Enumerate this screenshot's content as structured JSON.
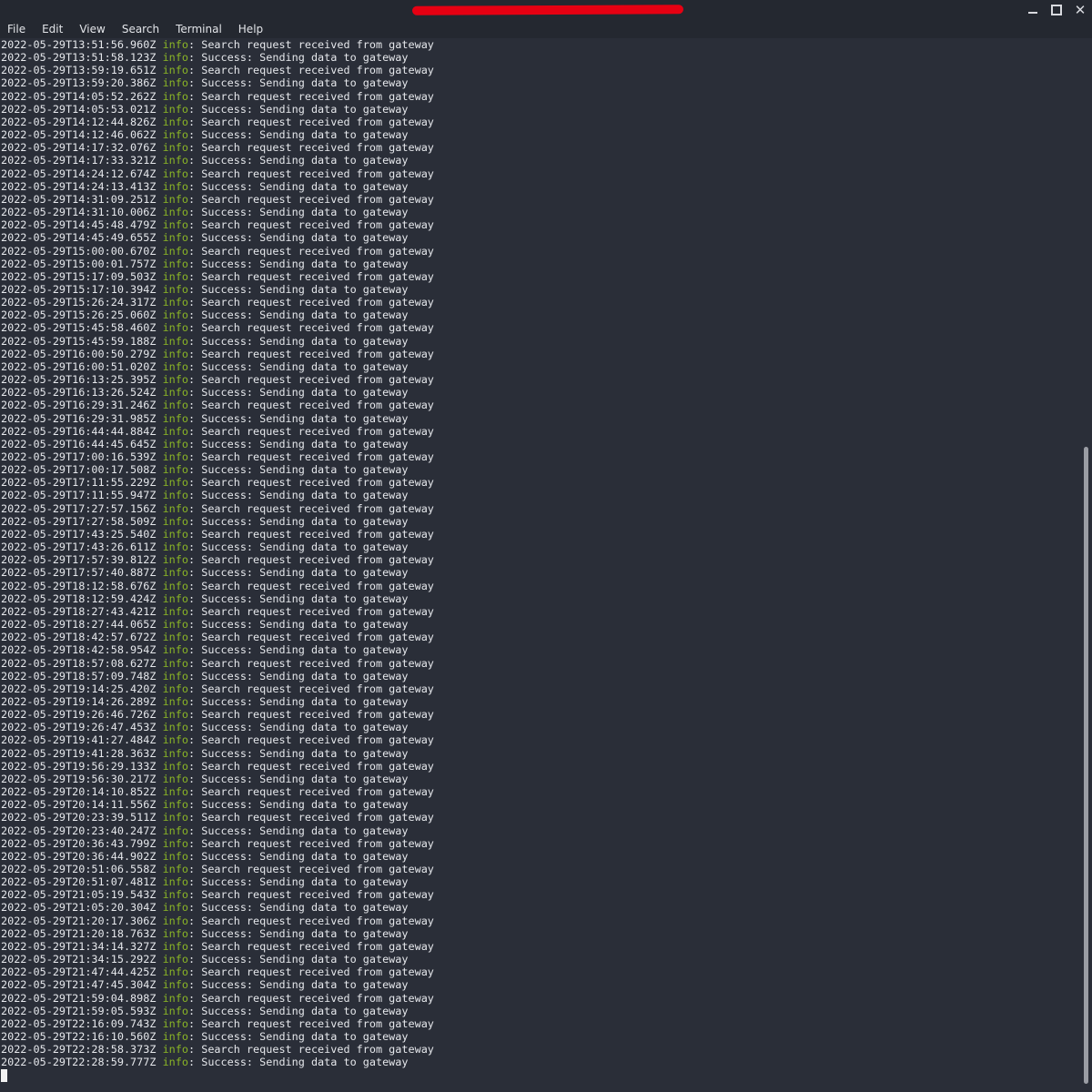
{
  "window": {
    "controls": {
      "minimize_icon": "minimize-icon",
      "maximize_icon": "maximize-icon",
      "close_glyph": "✕"
    }
  },
  "menu": [
    "File",
    "Edit",
    "View",
    "Search",
    "Terminal",
    "Help"
  ],
  "terminal": {
    "level_label": "info",
    "colors": {
      "background": "#2a2e38",
      "text": "#e6e8ec",
      "level": "#8ab526"
    },
    "log": [
      {
        "ts": "2022-05-29T13:51:56.960Z",
        "msg": "Search request received from gateway"
      },
      {
        "ts": "2022-05-29T13:51:58.123Z",
        "msg": "Success: Sending data to gateway"
      },
      {
        "ts": "2022-05-29T13:59:19.651Z",
        "msg": "Search request received from gateway"
      },
      {
        "ts": "2022-05-29T13:59:20.386Z",
        "msg": "Success: Sending data to gateway"
      },
      {
        "ts": "2022-05-29T14:05:52.262Z",
        "msg": "Search request received from gateway"
      },
      {
        "ts": "2022-05-29T14:05:53.021Z",
        "msg": "Success: Sending data to gateway"
      },
      {
        "ts": "2022-05-29T14:12:44.826Z",
        "msg": "Search request received from gateway"
      },
      {
        "ts": "2022-05-29T14:12:46.062Z",
        "msg": "Success: Sending data to gateway"
      },
      {
        "ts": "2022-05-29T14:17:32.076Z",
        "msg": "Search request received from gateway"
      },
      {
        "ts": "2022-05-29T14:17:33.321Z",
        "msg": "Success: Sending data to gateway"
      },
      {
        "ts": "2022-05-29T14:24:12.674Z",
        "msg": "Search request received from gateway"
      },
      {
        "ts": "2022-05-29T14:24:13.413Z",
        "msg": "Success: Sending data to gateway"
      },
      {
        "ts": "2022-05-29T14:31:09.251Z",
        "msg": "Search request received from gateway"
      },
      {
        "ts": "2022-05-29T14:31:10.006Z",
        "msg": "Success: Sending data to gateway"
      },
      {
        "ts": "2022-05-29T14:45:48.479Z",
        "msg": "Search request received from gateway"
      },
      {
        "ts": "2022-05-29T14:45:49.655Z",
        "msg": "Success: Sending data to gateway"
      },
      {
        "ts": "2022-05-29T15:00:00.670Z",
        "msg": "Search request received from gateway"
      },
      {
        "ts": "2022-05-29T15:00:01.757Z",
        "msg": "Success: Sending data to gateway"
      },
      {
        "ts": "2022-05-29T15:17:09.503Z",
        "msg": "Search request received from gateway"
      },
      {
        "ts": "2022-05-29T15:17:10.394Z",
        "msg": "Success: Sending data to gateway"
      },
      {
        "ts": "2022-05-29T15:26:24.317Z",
        "msg": "Search request received from gateway"
      },
      {
        "ts": "2022-05-29T15:26:25.060Z",
        "msg": "Success: Sending data to gateway"
      },
      {
        "ts": "2022-05-29T15:45:58.460Z",
        "msg": "Search request received from gateway"
      },
      {
        "ts": "2022-05-29T15:45:59.188Z",
        "msg": "Success: Sending data to gateway"
      },
      {
        "ts": "2022-05-29T16:00:50.279Z",
        "msg": "Search request received from gateway"
      },
      {
        "ts": "2022-05-29T16:00:51.020Z",
        "msg": "Success: Sending data to gateway"
      },
      {
        "ts": "2022-05-29T16:13:25.395Z",
        "msg": "Search request received from gateway"
      },
      {
        "ts": "2022-05-29T16:13:26.524Z",
        "msg": "Success: Sending data to gateway"
      },
      {
        "ts": "2022-05-29T16:29:31.246Z",
        "msg": "Search request received from gateway"
      },
      {
        "ts": "2022-05-29T16:29:31.985Z",
        "msg": "Success: Sending data to gateway"
      },
      {
        "ts": "2022-05-29T16:44:44.884Z",
        "msg": "Search request received from gateway"
      },
      {
        "ts": "2022-05-29T16:44:45.645Z",
        "msg": "Success: Sending data to gateway"
      },
      {
        "ts": "2022-05-29T17:00:16.539Z",
        "msg": "Search request received from gateway"
      },
      {
        "ts": "2022-05-29T17:00:17.508Z",
        "msg": "Success: Sending data to gateway"
      },
      {
        "ts": "2022-05-29T17:11:55.229Z",
        "msg": "Search request received from gateway"
      },
      {
        "ts": "2022-05-29T17:11:55.947Z",
        "msg": "Success: Sending data to gateway"
      },
      {
        "ts": "2022-05-29T17:27:57.156Z",
        "msg": "Search request received from gateway"
      },
      {
        "ts": "2022-05-29T17:27:58.509Z",
        "msg": "Success: Sending data to gateway"
      },
      {
        "ts": "2022-05-29T17:43:25.540Z",
        "msg": "Search request received from gateway"
      },
      {
        "ts": "2022-05-29T17:43:26.611Z",
        "msg": "Success: Sending data to gateway"
      },
      {
        "ts": "2022-05-29T17:57:39.812Z",
        "msg": "Search request received from gateway"
      },
      {
        "ts": "2022-05-29T17:57:40.887Z",
        "msg": "Success: Sending data to gateway"
      },
      {
        "ts": "2022-05-29T18:12:58.676Z",
        "msg": "Search request received from gateway"
      },
      {
        "ts": "2022-05-29T18:12:59.424Z",
        "msg": "Success: Sending data to gateway"
      },
      {
        "ts": "2022-05-29T18:27:43.421Z",
        "msg": "Search request received from gateway"
      },
      {
        "ts": "2022-05-29T18:27:44.065Z",
        "msg": "Success: Sending data to gateway"
      },
      {
        "ts": "2022-05-29T18:42:57.672Z",
        "msg": "Search request received from gateway"
      },
      {
        "ts": "2022-05-29T18:42:58.954Z",
        "msg": "Success: Sending data to gateway"
      },
      {
        "ts": "2022-05-29T18:57:08.627Z",
        "msg": "Search request received from gateway"
      },
      {
        "ts": "2022-05-29T18:57:09.748Z",
        "msg": "Success: Sending data to gateway"
      },
      {
        "ts": "2022-05-29T19:14:25.420Z",
        "msg": "Search request received from gateway"
      },
      {
        "ts": "2022-05-29T19:14:26.289Z",
        "msg": "Success: Sending data to gateway"
      },
      {
        "ts": "2022-05-29T19:26:46.726Z",
        "msg": "Search request received from gateway"
      },
      {
        "ts": "2022-05-29T19:26:47.453Z",
        "msg": "Success: Sending data to gateway"
      },
      {
        "ts": "2022-05-29T19:41:27.484Z",
        "msg": "Search request received from gateway"
      },
      {
        "ts": "2022-05-29T19:41:28.363Z",
        "msg": "Success: Sending data to gateway"
      },
      {
        "ts": "2022-05-29T19:56:29.133Z",
        "msg": "Search request received from gateway"
      },
      {
        "ts": "2022-05-29T19:56:30.217Z",
        "msg": "Success: Sending data to gateway"
      },
      {
        "ts": "2022-05-29T20:14:10.852Z",
        "msg": "Search request received from gateway"
      },
      {
        "ts": "2022-05-29T20:14:11.556Z",
        "msg": "Success: Sending data to gateway"
      },
      {
        "ts": "2022-05-29T20:23:39.511Z",
        "msg": "Search request received from gateway"
      },
      {
        "ts": "2022-05-29T20:23:40.247Z",
        "msg": "Success: Sending data to gateway"
      },
      {
        "ts": "2022-05-29T20:36:43.799Z",
        "msg": "Search request received from gateway"
      },
      {
        "ts": "2022-05-29T20:36:44.902Z",
        "msg": "Success: Sending data to gateway"
      },
      {
        "ts": "2022-05-29T20:51:06.558Z",
        "msg": "Search request received from gateway"
      },
      {
        "ts": "2022-05-29T20:51:07.481Z",
        "msg": "Success: Sending data to gateway"
      },
      {
        "ts": "2022-05-29T21:05:19.543Z",
        "msg": "Search request received from gateway"
      },
      {
        "ts": "2022-05-29T21:05:20.304Z",
        "msg": "Success: Sending data to gateway"
      },
      {
        "ts": "2022-05-29T21:20:17.306Z",
        "msg": "Search request received from gateway"
      },
      {
        "ts": "2022-05-29T21:20:18.763Z",
        "msg": "Success: Sending data to gateway"
      },
      {
        "ts": "2022-05-29T21:34:14.327Z",
        "msg": "Search request received from gateway"
      },
      {
        "ts": "2022-05-29T21:34:15.292Z",
        "msg": "Success: Sending data to gateway"
      },
      {
        "ts": "2022-05-29T21:47:44.425Z",
        "msg": "Search request received from gateway"
      },
      {
        "ts": "2022-05-29T21:47:45.304Z",
        "msg": "Success: Sending data to gateway"
      },
      {
        "ts": "2022-05-29T21:59:04.898Z",
        "msg": "Search request received from gateway"
      },
      {
        "ts": "2022-05-29T21:59:05.593Z",
        "msg": "Success: Sending data to gateway"
      },
      {
        "ts": "2022-05-29T22:16:09.743Z",
        "msg": "Search request received from gateway"
      },
      {
        "ts": "2022-05-29T22:16:10.560Z",
        "msg": "Success: Sending data to gateway"
      },
      {
        "ts": "2022-05-29T22:28:58.373Z",
        "msg": "Search request received from gateway"
      },
      {
        "ts": "2022-05-29T22:28:59.777Z",
        "msg": "Success: Sending data to gateway"
      }
    ]
  }
}
